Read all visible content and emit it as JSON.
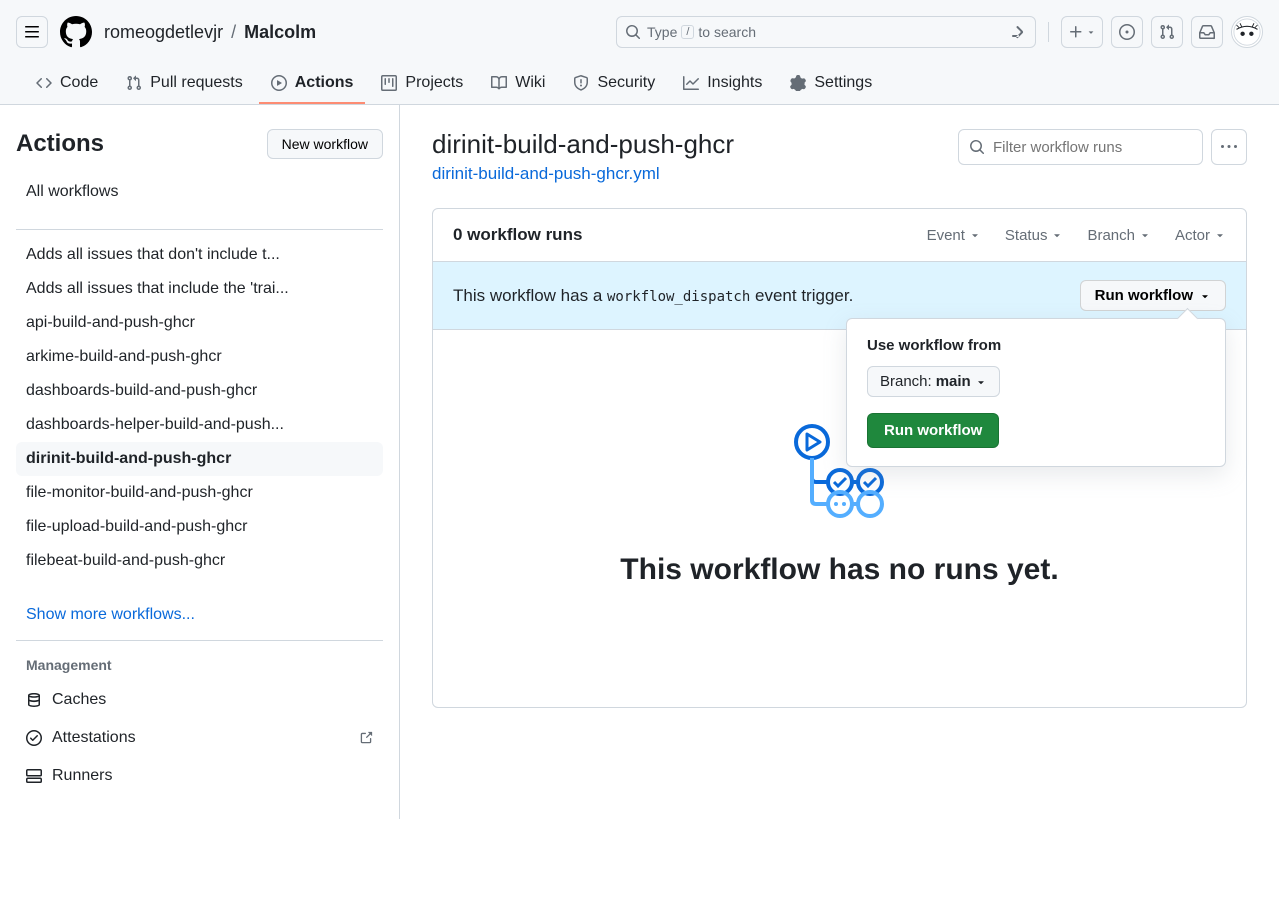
{
  "breadcrumb": {
    "owner": "romeogdetlevjr",
    "repo": "Malcolm"
  },
  "search": {
    "type_label": "Type",
    "slash": "/",
    "to_search": "to search"
  },
  "nav": {
    "code": "Code",
    "pulls": "Pull requests",
    "actions": "Actions",
    "projects": "Projects",
    "wiki": "Wiki",
    "security": "Security",
    "insights": "Insights",
    "settings": "Settings"
  },
  "sidebar": {
    "title": "Actions",
    "new_workflow": "New workflow",
    "all_workflows": "All workflows",
    "workflows": [
      "Adds all issues that don't include t...",
      "Adds all issues that include the 'trai...",
      "api-build-and-push-ghcr",
      "arkime-build-and-push-ghcr",
      "dashboards-build-and-push-ghcr",
      "dashboards-helper-build-and-push...",
      "dirinit-build-and-push-ghcr",
      "file-monitor-build-and-push-ghcr",
      "file-upload-build-and-push-ghcr",
      "filebeat-build-and-push-ghcr"
    ],
    "active_index": 6,
    "show_more": "Show more workflows...",
    "management": "Management",
    "caches": "Caches",
    "attestations": "Attestations",
    "runners": "Runners"
  },
  "workflow": {
    "name": "dirinit-build-and-push-ghcr",
    "file": "dirinit-build-and-push-ghcr.yml",
    "filter_placeholder": "Filter workflow runs",
    "runs_count": "0 workflow runs",
    "filters": {
      "event": "Event",
      "status": "Status",
      "branch": "Branch",
      "actor": "Actor"
    },
    "dispatch_prefix": "This workflow has a ",
    "dispatch_code": "workflow_dispatch",
    "dispatch_suffix": " event trigger.",
    "run_workflow": "Run workflow"
  },
  "popover": {
    "use_from": "Use workflow from",
    "branch_prefix": "Branch: ",
    "branch": "main",
    "run": "Run workflow"
  },
  "empty": {
    "message": "This workflow has no runs yet."
  }
}
